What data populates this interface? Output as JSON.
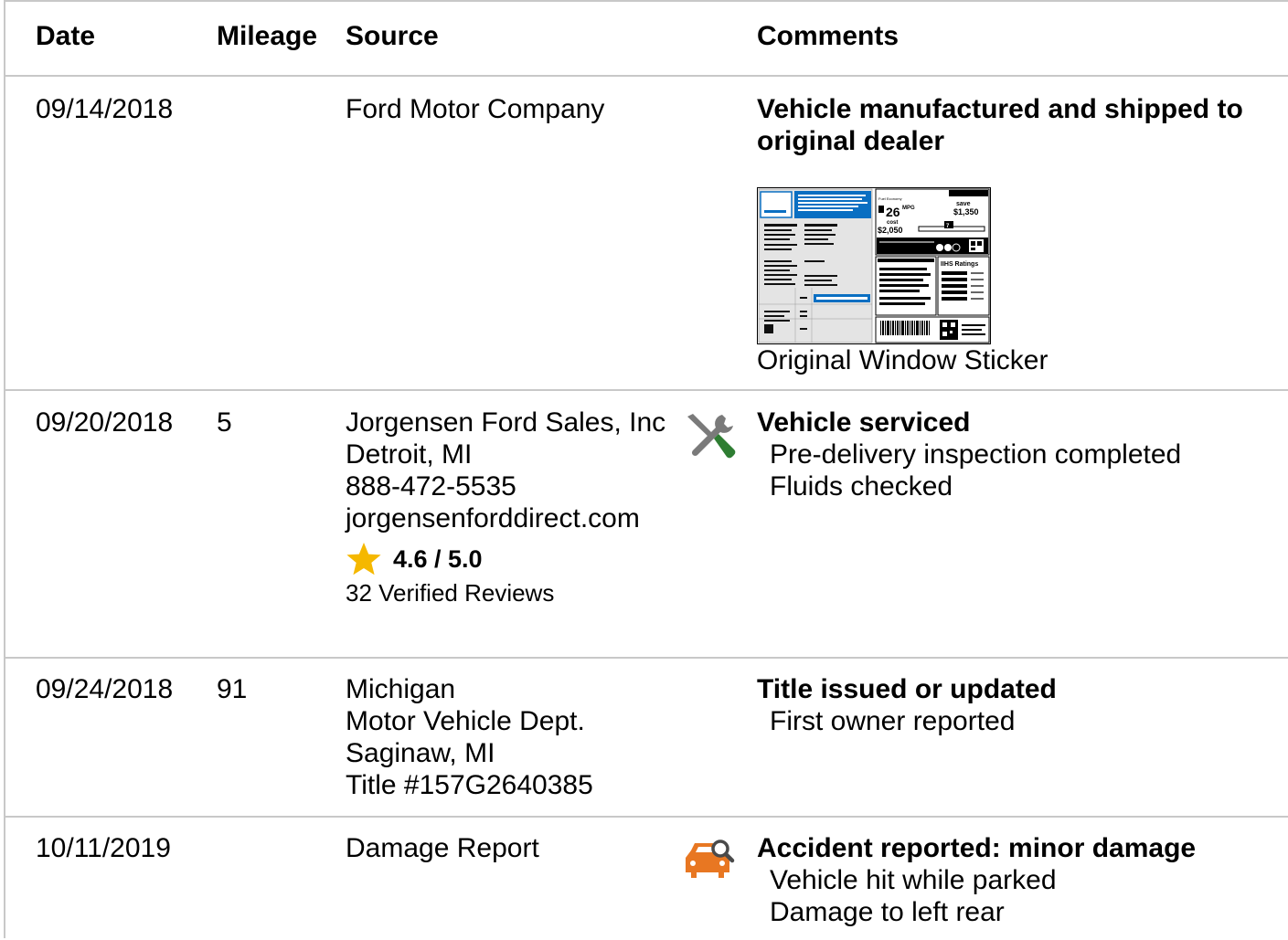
{
  "header": {
    "date": "Date",
    "mileage": "Mileage",
    "source": "Source",
    "comments": "Comments"
  },
  "records": [
    {
      "date": "09/14/2018",
      "mileage": "",
      "source": [
        "Ford Motor Company"
      ],
      "icon": "",
      "title": "Vehicle manufactured and shipped to original dealer",
      "details": [],
      "sticker_caption": "Original Window Sticker",
      "sticker": {
        "mpg": "26",
        "mpg_unit": "MPG",
        "save": "save",
        "save_amount": "$1,350",
        "cost": "cost",
        "cost_amount": "$2,050",
        "rating": "7",
        "ihs": "IIHS Ratings"
      }
    },
    {
      "date": "09/20/2018",
      "mileage": "5",
      "source": [
        "Jorgensen Ford Sales, Inc",
        "Detroit, MI",
        "888-472-5535",
        "jorgensenforddirect.com"
      ],
      "rating": "4.6 / 5.0",
      "reviews": "32 Verified Reviews",
      "icon": "wrench-screwdriver-icon",
      "title": "Vehicle serviced",
      "details": [
        "Pre-delivery inspection completed",
        "Fluids checked"
      ]
    },
    {
      "date": "09/24/2018",
      "mileage": "91",
      "source": [
        "Michigan",
        "Motor Vehicle Dept.",
        "Saginaw, MI",
        "Title #157G2640385"
      ],
      "icon": "",
      "title": "Title issued or updated",
      "details": [
        "First owner reported"
      ]
    },
    {
      "date": "10/11/2019",
      "mileage": "",
      "source": [
        "Damage Report"
      ],
      "icon": "car-search-icon",
      "title": "Accident reported: minor damage",
      "details": [
        "Vehicle hit while parked",
        "Damage to left rear"
      ]
    }
  ],
  "colors": {
    "star": "#f5b800",
    "wrench_handle": "#2e7d32",
    "tool_gray": "#7a7a7a",
    "accident": "#e87722",
    "border": "#c8c8c8",
    "sticker_blue": "#0a6fc2"
  }
}
